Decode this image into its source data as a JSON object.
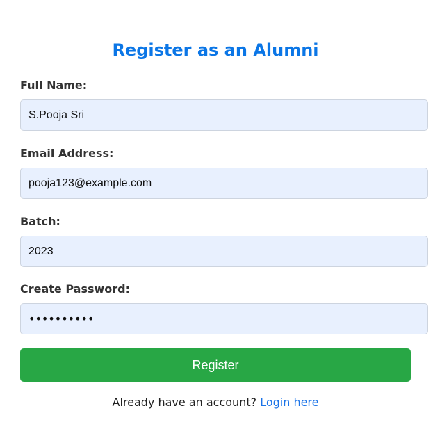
{
  "form": {
    "title": "Register as an Alumni",
    "fields": {
      "full_name": {
        "label": "Full Name:",
        "value": "S.Pooja Sri"
      },
      "email": {
        "label": "Email Address:",
        "value": "pooja123@example.com"
      },
      "batch": {
        "label": "Batch:",
        "value": "2023"
      },
      "password": {
        "label": "Create Password:",
        "value": "••••••••••"
      }
    },
    "submit_label": "Register",
    "footer_text": "Already have an account?",
    "login_link_label": "Login here"
  },
  "colors": {
    "title": "#0b76e6",
    "input_bg": "#e8f0fe",
    "button_bg": "#28a745",
    "link": "#1a73e8"
  }
}
